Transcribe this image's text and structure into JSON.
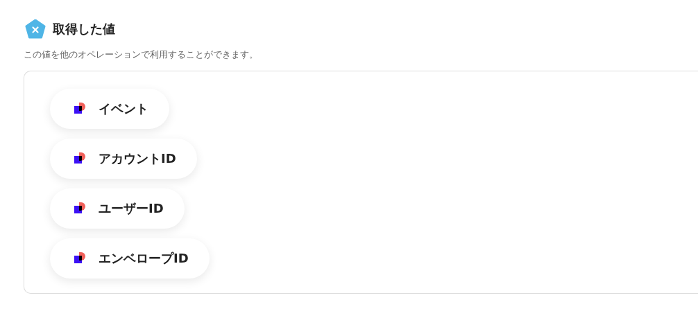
{
  "section": {
    "title": "取得した値",
    "description": "この値を他のオペレーションで利用することができます。"
  },
  "values": [
    {
      "label": "イベント"
    },
    {
      "label": "アカウントID"
    },
    {
      "label": "ユーザーID"
    },
    {
      "label": "エンベロープID"
    }
  ]
}
